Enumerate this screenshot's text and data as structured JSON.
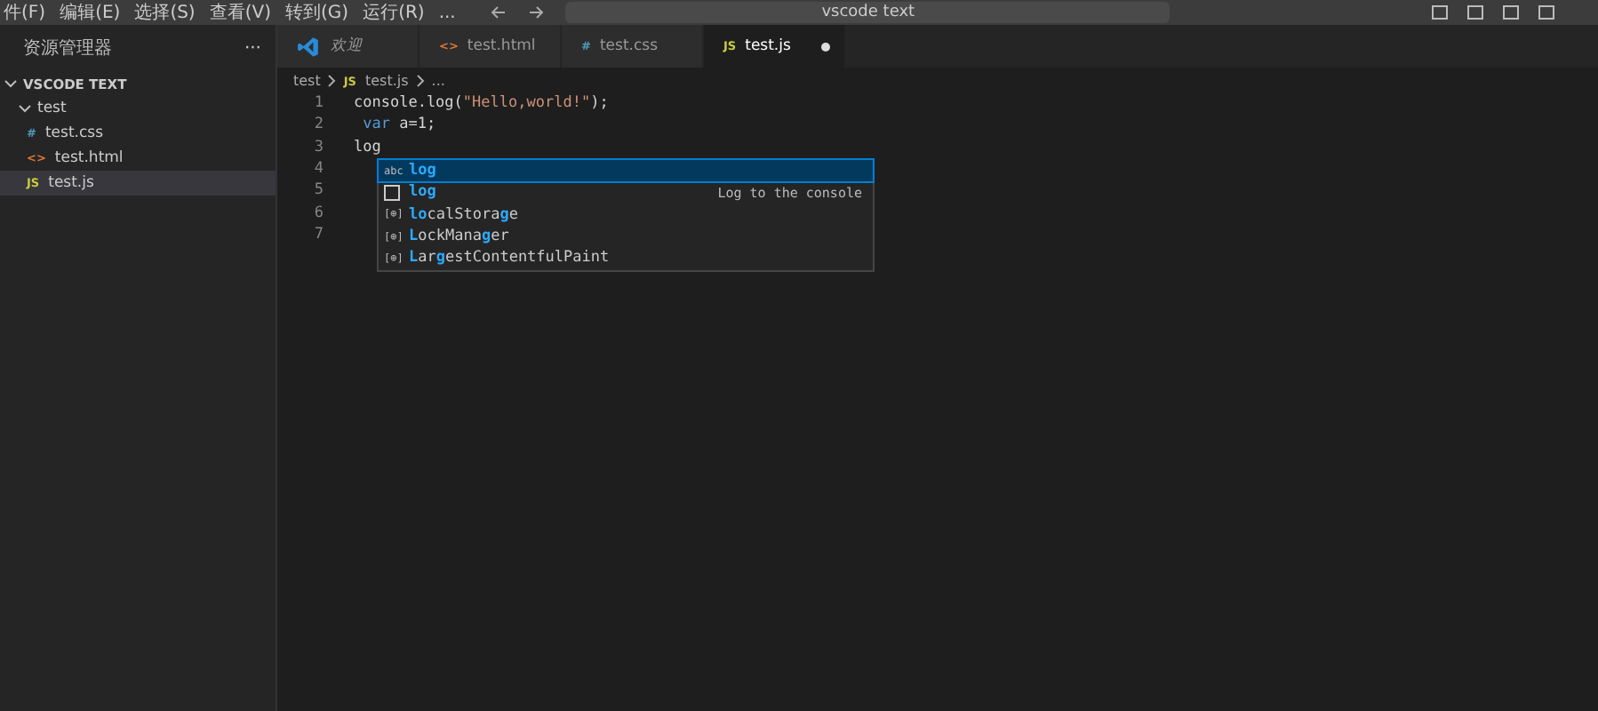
{
  "menu_bar": {
    "items": [
      "件(F)",
      "编辑(E)",
      "选择(S)",
      "查看(V)",
      "转到(G)",
      "运行(R)",
      "..."
    ],
    "search": {
      "value": "vscode text"
    }
  },
  "sidebar": {
    "title": "资源管理器",
    "more": "···",
    "root": {
      "label": "VSCODE TEXT",
      "expanded": true,
      "children": [
        {
          "label": "test",
          "expanded": true,
          "selected": false,
          "children": [
            {
              "label": "test.css",
              "icon": "#",
              "kind": "css",
              "selected": false
            },
            {
              "label": "test.html",
              "icon": "<>",
              "kind": "html",
              "selected": false
            },
            {
              "label": "test.js",
              "icon": "JS",
              "kind": "js",
              "selected": true
            }
          ]
        }
      ]
    }
  },
  "tabs": [
    {
      "label": "欢迎",
      "kind": "welcome",
      "selected": false,
      "italic": true,
      "dirty": false
    },
    {
      "label": "test.html",
      "icon": "<>",
      "kind": "html",
      "selected": false,
      "italic": false,
      "dirty": false
    },
    {
      "label": "test.css",
      "icon": "#",
      "kind": "css",
      "selected": false,
      "italic": false,
      "dirty": false
    },
    {
      "label": "test.js",
      "icon": "JS",
      "kind": "js",
      "selected": true,
      "italic": false,
      "dirty": true
    }
  ],
  "breadcrumb": [
    {
      "label": "test"
    },
    {
      "label": "test.js",
      "icon": "JS",
      "kind": "js"
    },
    {
      "label": "..."
    }
  ],
  "code_lines": [
    {
      "number": "1",
      "tokens": [
        {
          "text": "console.log(",
          "kind": "plain"
        },
        {
          "text": "\"Hello,world!\"",
          "kind": "string"
        },
        {
          "text": ");",
          "kind": "plain"
        }
      ]
    },
    {
      "number": "2",
      "tokens": [
        {
          "text": " var",
          "kind": "keyword"
        },
        {
          "text": " a=1;",
          "kind": "plain"
        }
      ]
    },
    {
      "number": "3",
      "tokens": [
        {
          "text": "log",
          "kind": "plain"
        }
      ]
    },
    {
      "number": "4"
    },
    {
      "number": "5"
    },
    {
      "number": "6"
    },
    {
      "number": "7"
    }
  ],
  "suggestions": [
    {
      "kind": "text",
      "icon": "abc",
      "selected": true,
      "parts": [
        {
          "text": "log",
          "match": true
        }
      ]
    },
    {
      "kind": "snippet",
      "selected": false,
      "parts": [
        {
          "text": "log",
          "match": true
        }
      ],
      "detail": "Log to the console"
    },
    {
      "kind": "variable",
      "icon": "[⊕]",
      "selected": false,
      "parts": [
        {
          "text": "lo",
          "match": true
        },
        {
          "text": "calStora",
          "match": false
        },
        {
          "text": "g",
          "match": true
        },
        {
          "text": "e",
          "match": false
        }
      ]
    },
    {
      "kind": "variable",
      "icon": "[⊕]",
      "selected": false,
      "parts": [
        {
          "text": "L",
          "match": true
        },
        {
          "text": "ockMana",
          "match": false
        },
        {
          "text": "g",
          "match": true
        },
        {
          "text": "er",
          "match": false
        }
      ]
    },
    {
      "kind": "variable",
      "icon": "[⊕]",
      "selected": false,
      "parts": [
        {
          "text": "L",
          "match": true
        },
        {
          "text": "ar",
          "match": false
        },
        {
          "text": "g",
          "match": true
        },
        {
          "text": "estContentfulPaint",
          "match": false
        }
      ]
    }
  ]
}
